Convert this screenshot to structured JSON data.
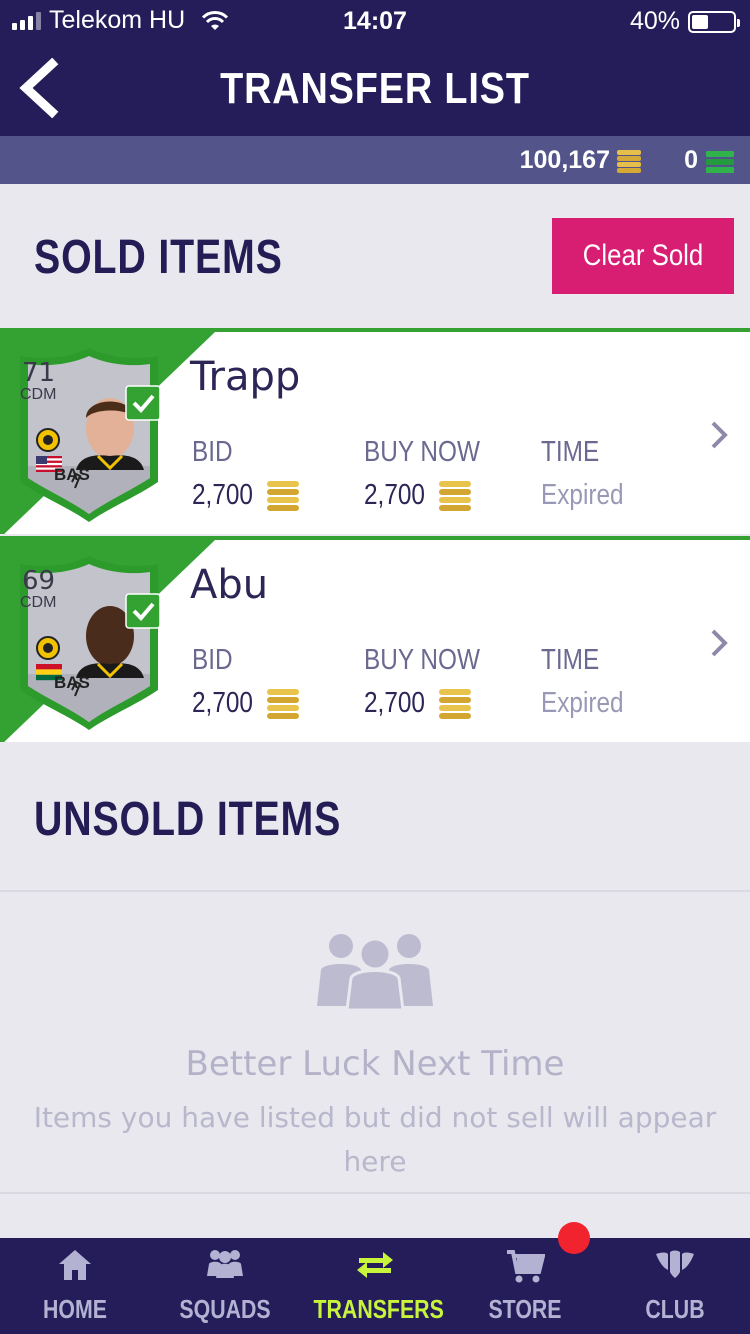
{
  "status_bar": {
    "carrier": "Telekom HU",
    "time": "14:07",
    "battery": "40%",
    "battery_level": 0.4
  },
  "header": {
    "title": "TRANSFER LIST"
  },
  "currency": {
    "coins": "100,167",
    "points": "0"
  },
  "sold": {
    "title": "SOLD ITEMS",
    "clear_label": "Clear Sold",
    "items": [
      {
        "name": "Trapp",
        "rating": "71",
        "position": "CDM",
        "chemistry": "BAS",
        "bid_label": "BID",
        "bid": "2,700",
        "buy_now_label": "BUY NOW",
        "buy_now": "2,700",
        "time_label": "TIME",
        "time": "Expired"
      },
      {
        "name": "Abu",
        "rating": "69",
        "position": "CDM",
        "chemistry": "BAS",
        "bid_label": "BID",
        "bid": "2,700",
        "buy_now_label": "BUY NOW",
        "buy_now": "2,700",
        "time_label": "TIME",
        "time": "Expired"
      }
    ]
  },
  "unsold": {
    "title": "UNSOLD ITEMS",
    "empty_title": "Better Luck Next Time",
    "empty_desc": "Items you have listed but did not sell will appear here"
  },
  "tabs": [
    {
      "label": "HOME",
      "icon": "home-icon",
      "active": false
    },
    {
      "label": "SQUADS",
      "icon": "squads-icon",
      "active": false
    },
    {
      "label": "TRANSFERS",
      "icon": "transfers-icon",
      "active": true
    },
    {
      "label": "STORE",
      "icon": "cart-icon",
      "active": false
    },
    {
      "label": "CLUB",
      "icon": "club-icon",
      "active": false
    }
  ],
  "colors": {
    "navy": "#251d5a",
    "accent": "#d71e72",
    "green": "#34a233",
    "active_tab": "#c8f53c"
  }
}
